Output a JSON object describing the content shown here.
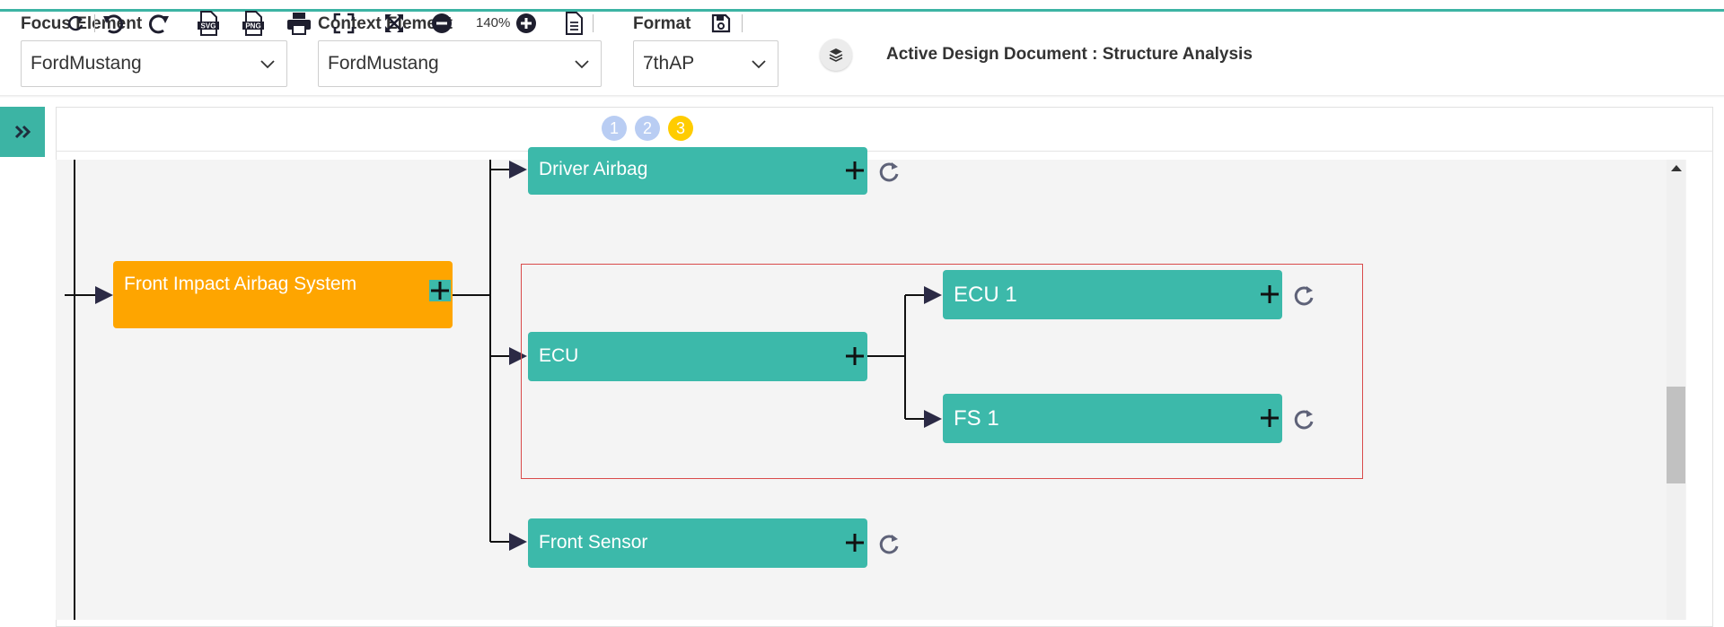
{
  "header": {
    "focus_label": "Focus Element",
    "focus_value": "FordMustang",
    "context_label": "Context Element",
    "context_value": "FordMustang",
    "format_label": "Format",
    "format_value": "7thAP",
    "active_doc": "Active Design Document : Structure Analysis"
  },
  "toolbar": {
    "zoom": "140%",
    "levels": [
      "1",
      "2",
      "3"
    ],
    "svg_label": "SVG",
    "png_label": "PNG"
  },
  "diagram": {
    "nodes": {
      "root": "Front Impact Airbag System",
      "driver_airbag": "Driver Airbag",
      "ecu": "ECU",
      "ecu1": "ECU 1",
      "fs1": "FS 1",
      "front_sensor": "Front Sensor"
    }
  },
  "colors": {
    "accent": "#3cb4a4",
    "node_teal": "#3cb9aa",
    "node_orange": "#fea500",
    "level_light": "#b9cdf3",
    "level_active": "#ffcc00",
    "selection": "#d94a4a"
  }
}
